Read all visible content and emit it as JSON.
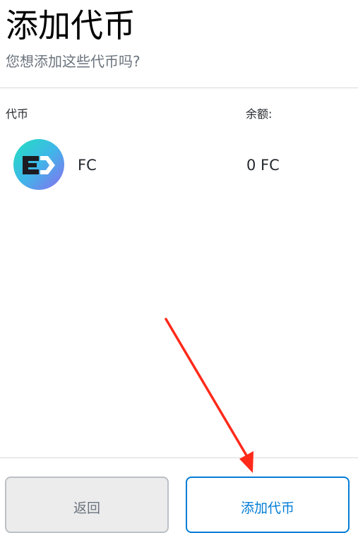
{
  "header": {
    "title": "添加代币",
    "subtitle": "您想添加这些代币吗?"
  },
  "table": {
    "col_token": "代币",
    "col_balance": "余额:"
  },
  "tokens": [
    {
      "icon": "fc-token-logo",
      "symbol": "FC",
      "balance": "0 FC"
    }
  ],
  "footer": {
    "back_label": "返回",
    "add_label": "添加代币"
  },
  "colors": {
    "accent": "#037dd6",
    "annotation_arrow": "#ff2a1a",
    "logo_gradient_start": "#22e0c0",
    "logo_gradient_end": "#8b6cf0"
  }
}
